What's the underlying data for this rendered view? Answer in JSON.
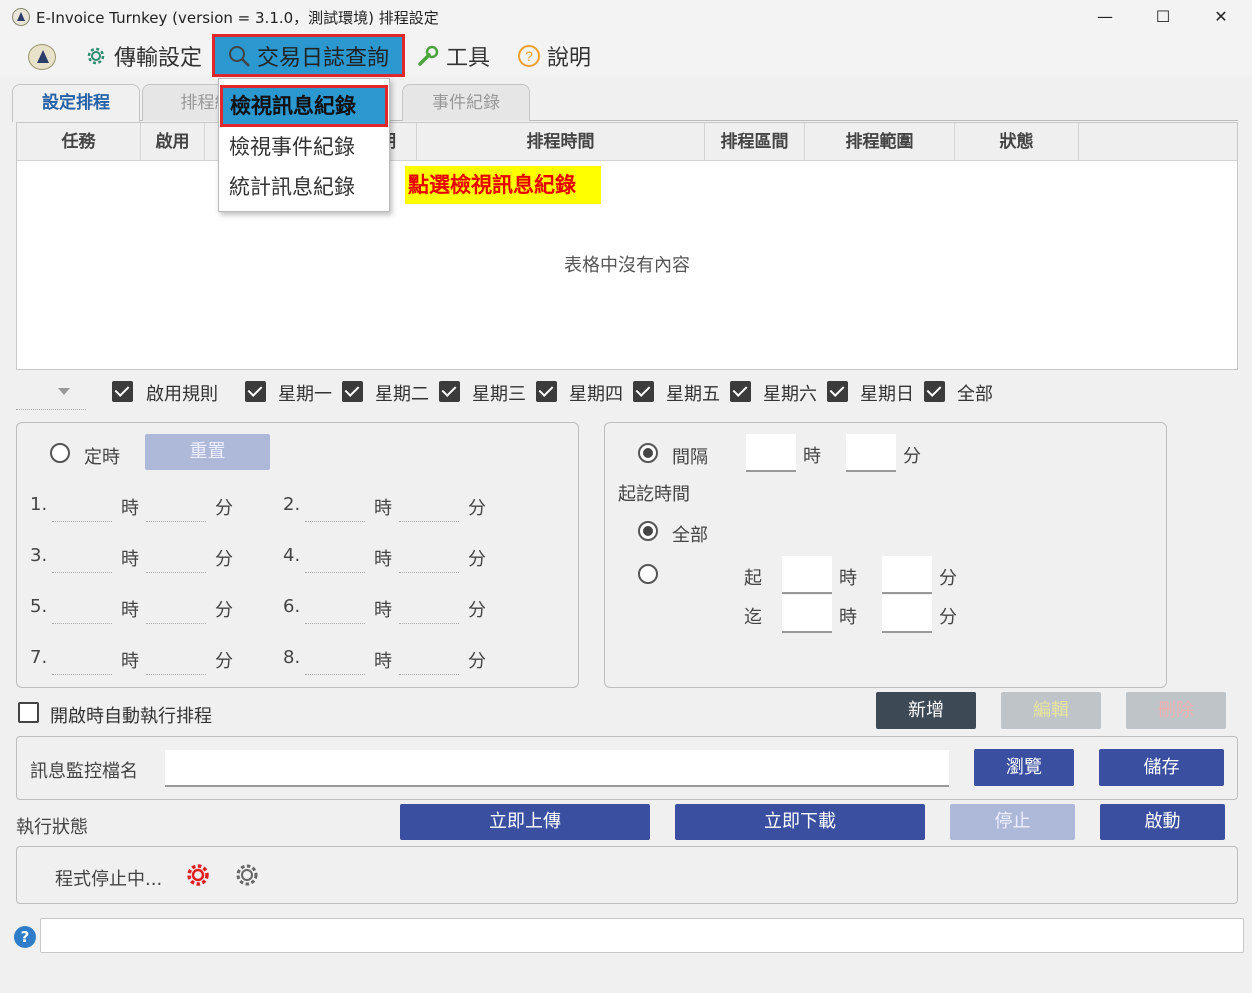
{
  "window": {
    "title": "E-Invoice Turnkey (version = 3.1.0，測試環境) 排程設定",
    "minimize": "—",
    "maximize": "☐",
    "close": "✕"
  },
  "menu": {
    "transfer": "傳輸設定",
    "query": "交易日誌查詢",
    "tools": "工具",
    "help": "說明"
  },
  "dropdown": {
    "items": [
      "檢視訊息紀錄",
      "檢視事件紀錄",
      "統計訊息紀錄"
    ]
  },
  "note": "點選檢視訊息紀錄",
  "tabs": [
    "設定排程",
    "排程紀",
    "事件紀錄"
  ],
  "table": {
    "headers": [
      "任務",
      "啟用",
      "星期",
      "排程時間",
      "排程區間",
      "排程範圍",
      "狀態"
    ],
    "empty": "表格中沒有內容"
  },
  "rules": {
    "enable": "啟用規則",
    "days": [
      "星期一",
      "星期二",
      "星期三",
      "星期四",
      "星期五",
      "星期六",
      "星期日",
      "全部"
    ]
  },
  "timed": {
    "label": "定時",
    "reset": "重置",
    "nums": [
      "1.",
      "2.",
      "3.",
      "4.",
      "5.",
      "6.",
      "7.",
      "8."
    ],
    "hour": "時",
    "minute": "分"
  },
  "interval": {
    "label": "間隔",
    "hour": "時",
    "minute": "分",
    "range_title": "起訖時間",
    "all": "全部",
    "from": "起",
    "to": "迄"
  },
  "autostart": "開啟時自動執行排程",
  "buttons": {
    "add": "新增",
    "edit": "編輯",
    "delete": "刪除",
    "browse": "瀏覽",
    "save": "儲存",
    "upload": "立即上傳",
    "download": "立即下載",
    "stop": "停止",
    "start": "啟動"
  },
  "monitor_label": "訊息監控檔名",
  "exec_status_label": "執行狀態",
  "program_status": "程式停止中...",
  "help_glyph": "?"
}
